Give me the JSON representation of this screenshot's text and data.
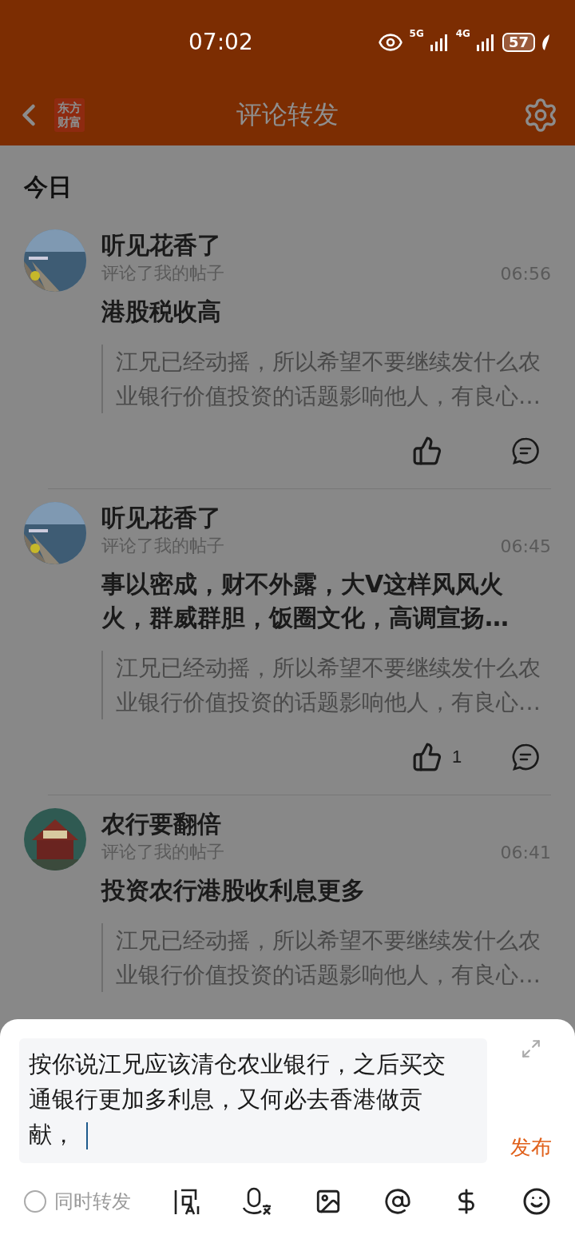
{
  "status_bar": {
    "time": "07:02",
    "network_1": "5G",
    "network_2": "4G",
    "battery": "57"
  },
  "nav": {
    "logo": [
      "东方",
      "财富"
    ],
    "title": "评论转发"
  },
  "section": "今日",
  "notifications": [
    {
      "name": "听见花香了",
      "action": "评论了我的帖子",
      "time": "06:56",
      "title": "港股税收高",
      "quote": "江兄已经动摇，所以希望不要继续发什么农业银行价值投资的话题影响他人，有良心…",
      "actions_shown": true
    },
    {
      "name": "听见花香了",
      "action": "评论了我的帖子",
      "time": "06:45",
      "title": "事以密成，财不外露，大V这样风风火火，群威群胆，饭圈文化，高调宣扬…",
      "quote": "江兄已经动摇，所以希望不要继续发什么农业银行价值投资的话题影响他人，有良心…",
      "actions_shown": true,
      "likes": "1"
    },
    {
      "name": "农行要翻倍",
      "action": "评论了我的帖子",
      "time": "06:41",
      "title": "投资农行港股收利息更多",
      "quote": "江兄已经动摇，所以希望不要继续发什么农业银行价值投资的话题影响他人，有良心…"
    }
  ],
  "composer": {
    "value": "按你说江兄应该清仓农业银行，之后买交通银行更加多利息，又何必去香港做贡献，",
    "publish": "发布",
    "repost": {
      "label": "同时转发",
      "checked": false
    }
  }
}
